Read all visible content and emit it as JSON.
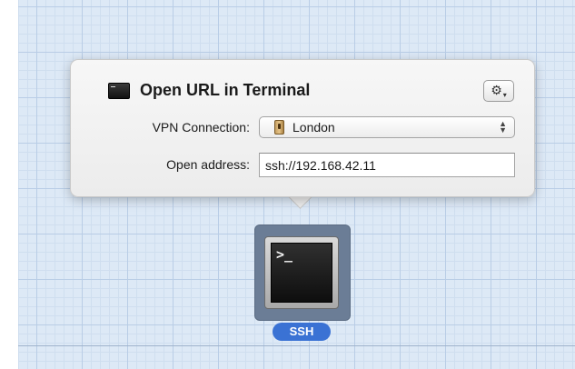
{
  "popover": {
    "title": "Open URL in Terminal",
    "gear_symbol": "⚙",
    "gear_caret": "▾",
    "vpn_label": "VPN Connection:",
    "vpn_value": "London",
    "address_label": "Open address:",
    "address_value": "ssh://192.168.42.11"
  },
  "icon": {
    "name": "terminal-icon",
    "prompt": ">_",
    "label": "SSH"
  },
  "colors": {
    "grid_background": "#dde9f6",
    "label_pill": "#3a72d4"
  }
}
